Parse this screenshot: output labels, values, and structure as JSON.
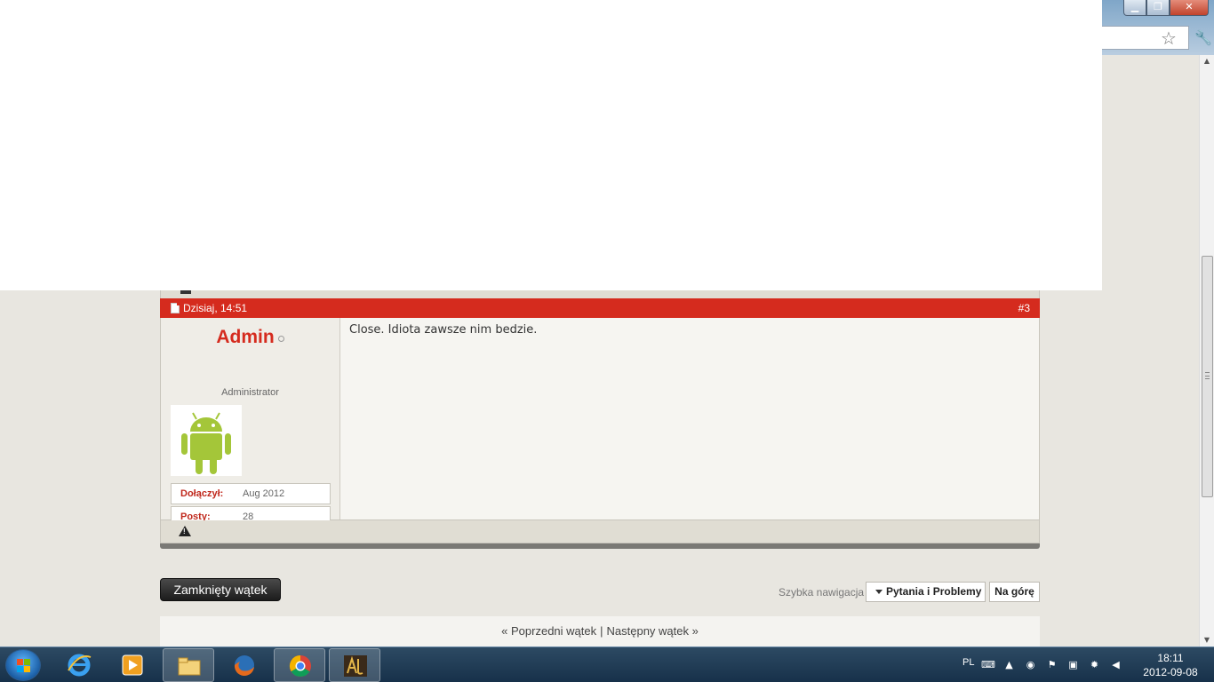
{
  "browser": {
    "controls": {
      "minimize": "▁",
      "maximize": "❐",
      "close": "✕"
    },
    "icons": [
      "star-icon",
      "wrench-icon"
    ]
  },
  "post": {
    "date": "Dzisiaj, 14:51",
    "number": "#3",
    "username": "Admin",
    "user_title": "Administrator",
    "avatar": "android-robot",
    "info": [
      {
        "label": "Dołączył:",
        "value": "Aug 2012"
      },
      {
        "label": "Posty:",
        "value": "28"
      }
    ],
    "message": "Close. Idiota zawsze nim bedzie.",
    "colors": {
      "header": "#d52b1e",
      "username": "#d52b1e",
      "avatar": "#a4c639"
    }
  },
  "actions": {
    "closed_thread": "Zamknięty wątek",
    "quick_nav_label": "Szybka nawigacja",
    "quick_nav_selected": "Pytania i Problemy",
    "top": "Na górę"
  },
  "thread_nav": {
    "prev": "« Poprzedni wątek",
    "separator": "|",
    "next": "Następny wątek »"
  },
  "taskbar": {
    "apps": [
      "internet-explorer",
      "media-player",
      "file-explorer",
      "firefox",
      "chrome",
      "game"
    ],
    "active_app": "chrome",
    "tray": {
      "language": "PL",
      "time": "18:11",
      "date": "2012-09-08"
    }
  }
}
